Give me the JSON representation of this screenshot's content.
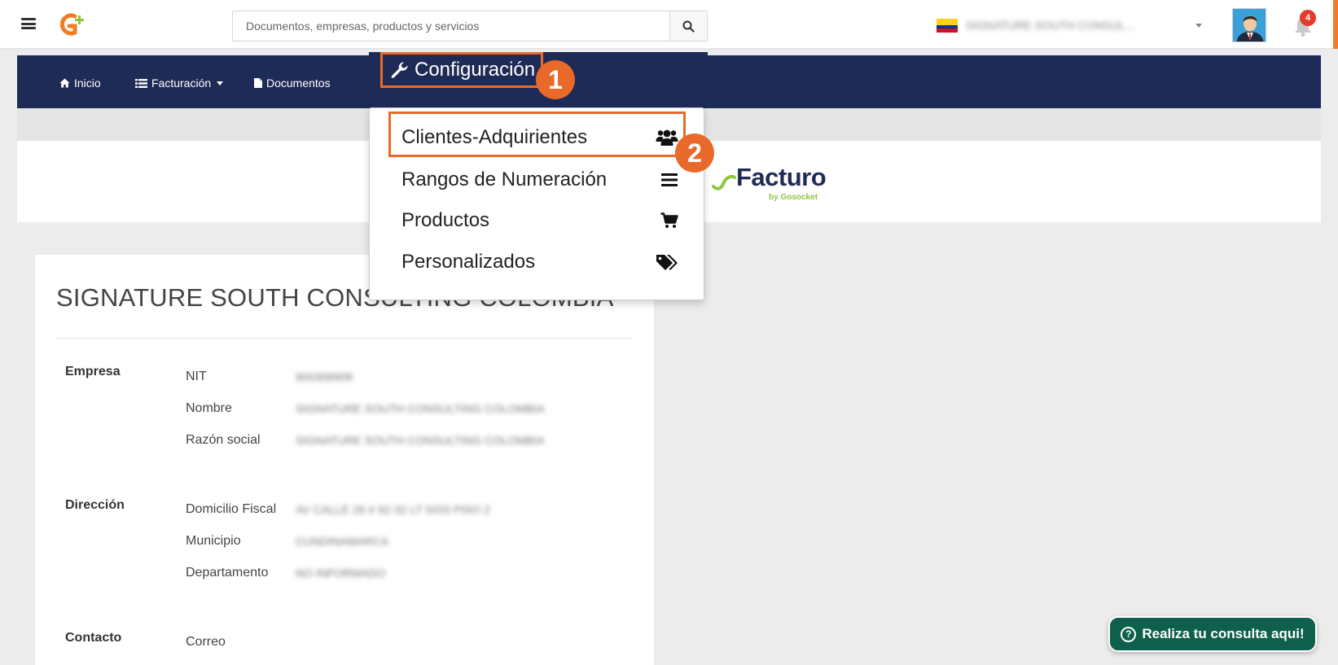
{
  "header": {
    "search": {
      "placeholder": "Documentos, empresas, productos y servicios"
    },
    "company_selector": {
      "value": "SIGNATURE SOUTH CONSUL..."
    },
    "notifications": {
      "count": "4"
    },
    "colors": {
      "accent": "#e8692a",
      "nav": "#1f2b57",
      "help": "#0e5f4b"
    }
  },
  "navbar": {
    "items": [
      {
        "label": "Inicio",
        "icon": "home-icon"
      },
      {
        "label": "Facturación",
        "icon": "list-icon"
      },
      {
        "label": "Documentos",
        "icon": "file-icon"
      }
    ],
    "config": {
      "label": "Configuración",
      "icon": "wrench-icon",
      "step": "1"
    }
  },
  "dropdown": {
    "step": "2",
    "items": [
      {
        "label": "Clientes-Adquirientes",
        "icon": "users-icon"
      },
      {
        "label": "Rangos de Numeración",
        "icon": "bars-icon"
      },
      {
        "label": "Productos",
        "icon": "cart-icon"
      },
      {
        "label": "Personalizados",
        "icon": "tags-icon"
      }
    ]
  },
  "brand": {
    "name": "Facturo",
    "sub": "by Gosocket"
  },
  "company": {
    "title": "SIGNATURE SOUTH CONSULTING COLOMBIA",
    "sections": [
      {
        "label": "Empresa",
        "fields": [
          {
            "label": "NIT",
            "value": "900308908"
          },
          {
            "label": "Nombre",
            "value": "SIGNATURE SOUTH CONSULTING COLOMBIA"
          },
          {
            "label": "Razón social",
            "value": "SIGNATURE SOUTH CONSULTING COLOMBIA"
          }
        ]
      },
      {
        "label": "Dirección",
        "fields": [
          {
            "label": "Domicilio Fiscal",
            "value": "AV CALLE 26 # 92-32 LT 5/G5 PISO 2"
          },
          {
            "label": "Municipio",
            "value": "CUNDINAMARCA"
          },
          {
            "label": "Departamento",
            "value": "NO INFORMADO"
          }
        ]
      },
      {
        "label": "Contacto",
        "fields": [
          {
            "label": "Correo",
            "value": ""
          }
        ]
      }
    ]
  },
  "help": {
    "label": "Realiza tu consulta aqui!"
  }
}
